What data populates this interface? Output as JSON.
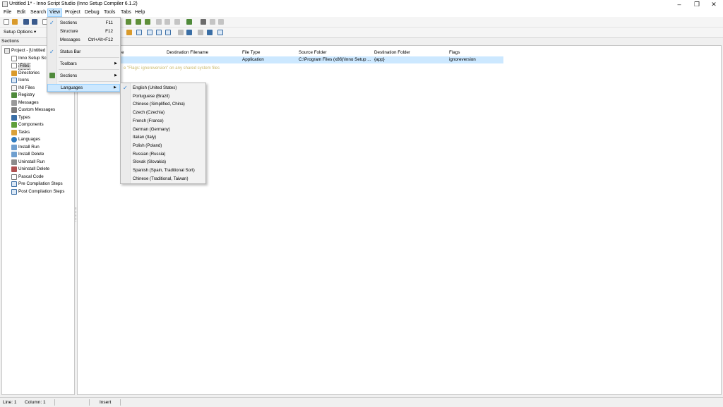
{
  "window": {
    "title": "Untitled 1* - Inno Script Studio (Inno Setup Compiler 6.1.2)",
    "controls": [
      "–",
      "❐",
      "✕"
    ]
  },
  "menubar": [
    "File",
    "Edit",
    "Search",
    "View",
    "Project",
    "Debug",
    "Tools",
    "Tabs",
    "Help"
  ],
  "toolbar": {
    "setup_options": "Setup Options"
  },
  "sections": {
    "header": "Sections",
    "items": [
      "Project - [Untitled 1]",
      "Inno Setup Script",
      "Files",
      "Directories",
      "Icons",
      "INI Files",
      "Registry",
      "Messages",
      "Custom Messages",
      "Types",
      "Components",
      "Tasks",
      "Languages",
      "Install Run",
      "Install Delete",
      "Uninstall Run",
      "Uninstall Delete",
      "Pascal Code",
      "Pre Compilation Steps",
      "Post Compilation Steps"
    ]
  },
  "files_table": {
    "headers": [
      "Source Filename",
      "Destination Filename",
      "File Type",
      "Source Folder",
      "Destination Folder",
      "Flags"
    ],
    "header_partial": "e",
    "row": {
      "file_type": "Application",
      "source_folder": "C:\\Program Files (x86)\\Inno Setup ...",
      "destination_folder": "{app}",
      "flags": "ignoreversion"
    },
    "hint": "e \"Flags: ignoreversion\" on any shared system files"
  },
  "view_menu": {
    "items": [
      {
        "label": "Sections",
        "shortcut": "F11",
        "checked": true
      },
      {
        "label": "Structure",
        "shortcut": "F12",
        "checked": false
      },
      {
        "label": "Messages",
        "shortcut": "Ctrl+Alt+F12",
        "checked": false
      },
      {
        "label": "Status Bar",
        "shortcut": "",
        "checked": true
      },
      {
        "label": "Toolbars",
        "shortcut": "",
        "submenu": true
      },
      {
        "label": "Sections",
        "shortcut": "",
        "submenu": true
      },
      {
        "label": "Languages",
        "shortcut": "",
        "submenu": true,
        "highlighted": true
      }
    ]
  },
  "languages_menu": {
    "items": [
      "English (United States)",
      "Portuguese (Brazil)",
      "Chinese (Simplified, China)",
      "Czech (Czechia)",
      "French (France)",
      "German (Germany)",
      "Italian (Italy)",
      "Polish (Poland)",
      "Russian (Russia)",
      "Slovak (Slovakia)",
      "Spanish (Spain, Traditional Sort)",
      "Chinese (Traditional, Taiwan)"
    ],
    "selected_index": 0
  },
  "statusbar": {
    "line": "Line: 1",
    "column": "Column: 1",
    "mode": "Insert"
  },
  "colors": {
    "accent": "#cce8ff",
    "check": "#2a7fd4",
    "hint": "#c8b86a"
  }
}
